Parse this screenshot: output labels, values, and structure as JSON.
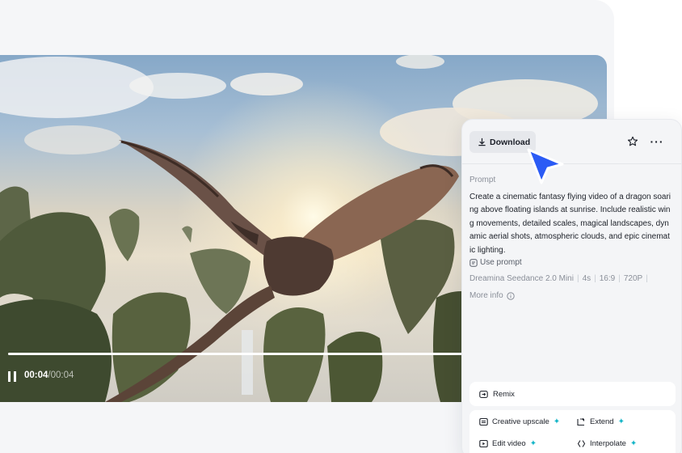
{
  "player": {
    "time_current": "00:04",
    "time_separator": "/",
    "time_total": "00:04",
    "progress": 1.0
  },
  "panel": {
    "download_label": "Download",
    "prompt_label": "Prompt",
    "prompt_text": "Create a cinematic fantasy flying video of a dragon soaring above floating islands at sunrise. Include realistic wing movements, detailed scales, magical landscapes, dynamic aerial shots, atmospheric clouds, and epic cinematic lighting.",
    "use_prompt_label": "Use prompt",
    "meta": [
      "Dreamina Seedance 2.0 Mini",
      "4s",
      "16:9",
      "720P"
    ],
    "more_info_label": "More info",
    "remix_label": "Remix",
    "tools": {
      "creative_upscale": "Creative upscale",
      "extend": "Extend",
      "edit_video": "Edit video",
      "interpolate": "Interpolate"
    }
  },
  "icons": [
    "pause-icon",
    "download-icon",
    "star-icon",
    "more-icon",
    "use-prompt-icon",
    "info-icon",
    "remix-icon",
    "upscale-icon",
    "extend-icon",
    "edit-video-icon",
    "interpolate-icon",
    "sparkle-icon",
    "cursor-pointer-icon"
  ],
  "colors": {
    "accent_sparkle": "#17b6c8",
    "cursor": "#2b5bf5",
    "panel_bg": "#f4f5f7"
  }
}
